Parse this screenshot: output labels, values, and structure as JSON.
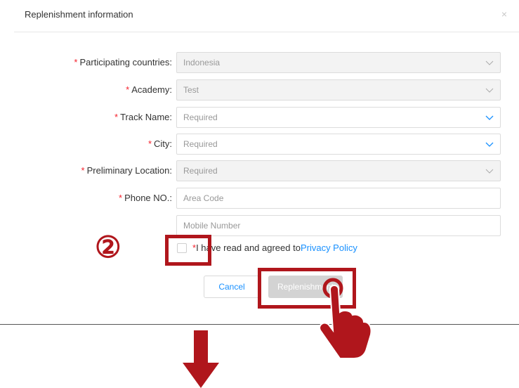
{
  "dialog": {
    "title": "Replenishment information",
    "close_glyph": "×"
  },
  "form": {
    "required_mark": "*",
    "rows": [
      {
        "label": "Participating countries:",
        "value": "Indonesia",
        "placeholder": "",
        "disabled": true,
        "chevron_color": "#aaaaaa"
      },
      {
        "label": "Academy:",
        "value": "Test",
        "placeholder": "",
        "disabled": true,
        "chevron_color": "#aaaaaa"
      },
      {
        "label": "Track Name:",
        "value": "",
        "placeholder": "Required",
        "disabled": false,
        "chevron_color": "#1890ff"
      },
      {
        "label": "City:",
        "value": "",
        "placeholder": "Required",
        "disabled": false,
        "chevron_color": "#1890ff"
      },
      {
        "label": "Preliminary Location:",
        "value": "",
        "placeholder": "Required",
        "disabled": true,
        "chevron_color": "#aaaaaa"
      }
    ],
    "phone_label": "Phone NO.:",
    "area_code_placeholder": "Area Code",
    "mobile_placeholder": "Mobile Number",
    "agree_prefix": "I have read and agreed to",
    "privacy_link": "Privacy Policy",
    "cancel_label": "Cancel",
    "replenish_label": "Replenishment"
  },
  "annotations": {
    "step_marker": "②",
    "highlight_color": "#b0161c"
  },
  "colors": {
    "accent": "#1890ff",
    "required": "#f5222d",
    "annotation": "#b0161c"
  }
}
